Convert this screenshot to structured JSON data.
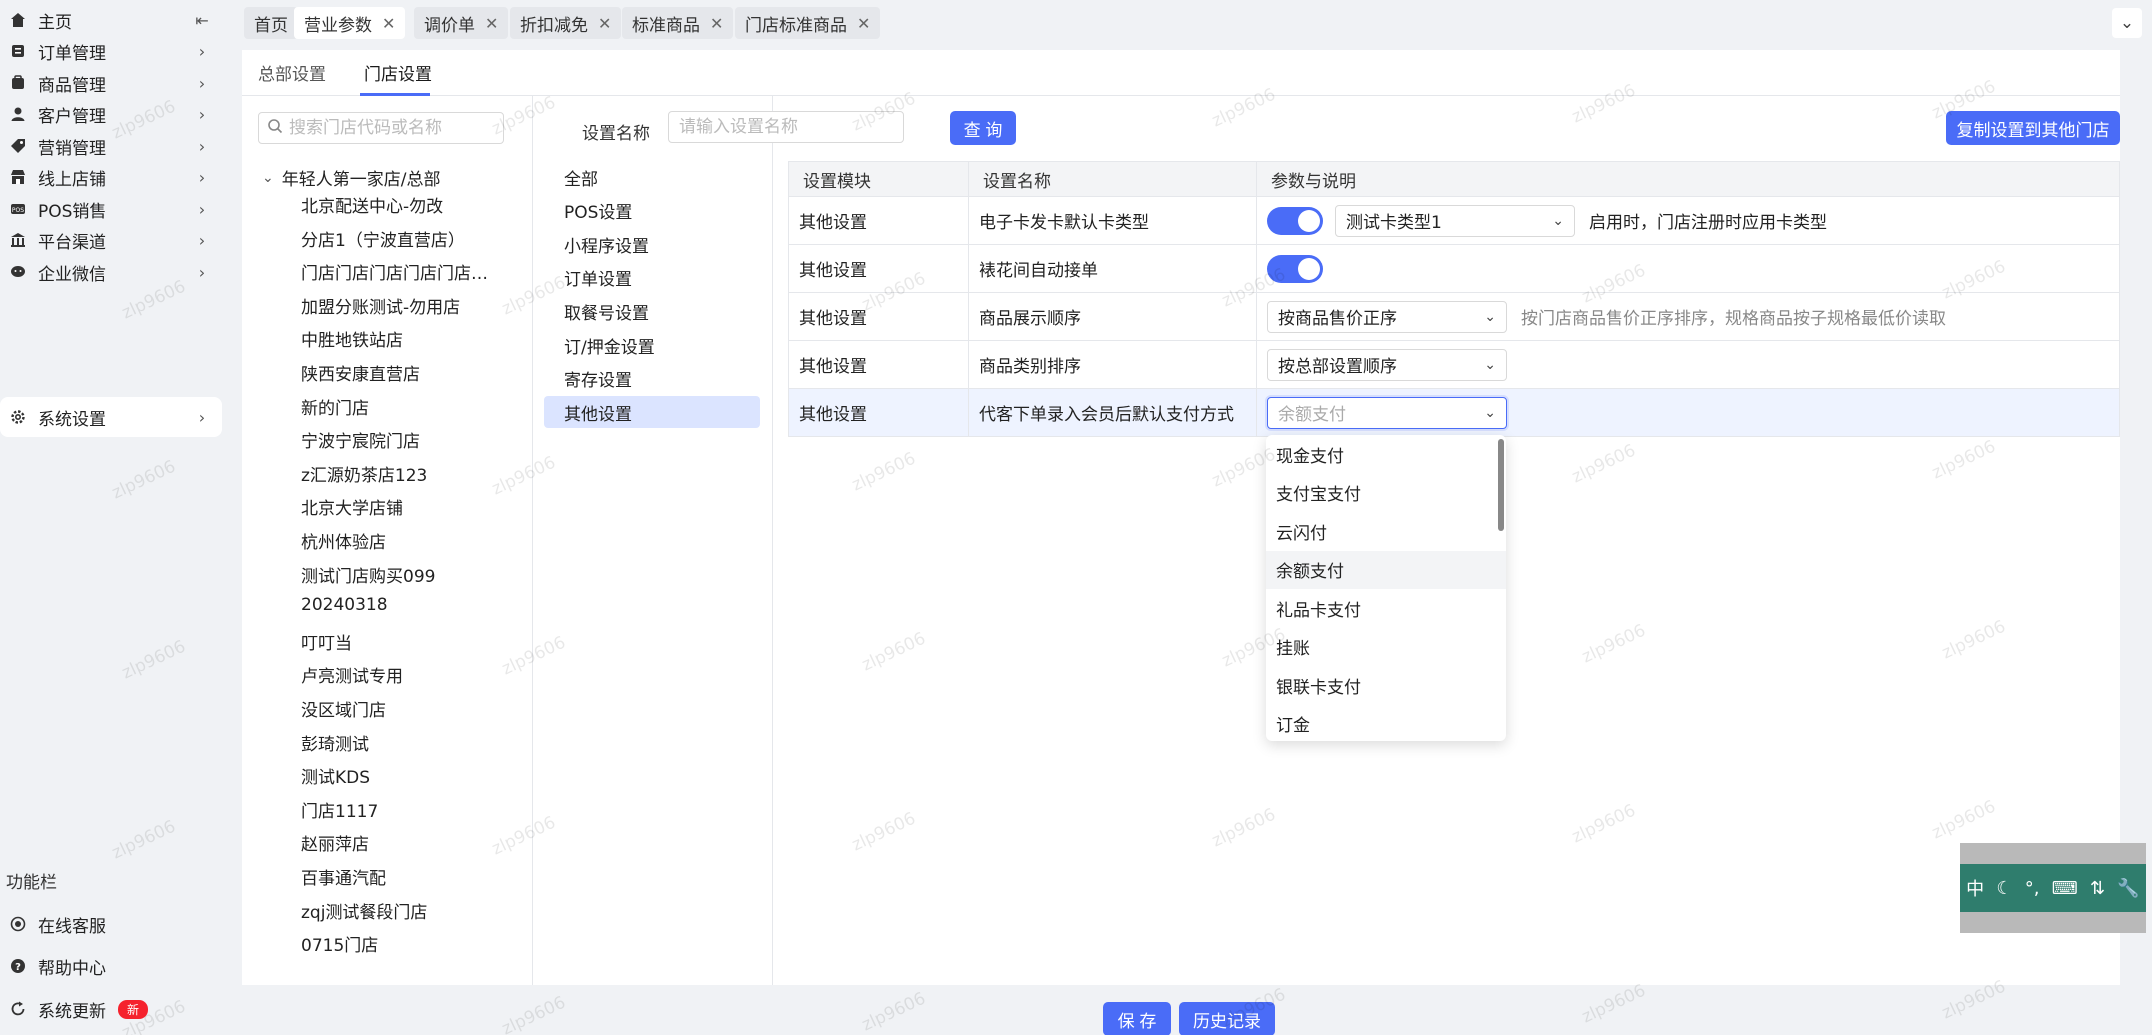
{
  "sidebar": {
    "items": [
      {
        "label": "主页",
        "icon": "home-icon",
        "trailing": "collapse"
      },
      {
        "label": "订单管理",
        "icon": "order-icon"
      },
      {
        "label": "商品管理",
        "icon": "goods-icon"
      },
      {
        "label": "客户管理",
        "icon": "user-icon"
      },
      {
        "label": "营销管理",
        "icon": "tag-icon"
      },
      {
        "label": "线上店铺",
        "icon": "shop-icon"
      },
      {
        "label": "POS销售",
        "icon": "pos-icon"
      },
      {
        "label": "平台渠道",
        "icon": "channel-icon"
      },
      {
        "label": "企业微信",
        "icon": "wechat-icon"
      },
      {
        "label": "系统设置",
        "icon": "gear-icon",
        "active": true
      }
    ],
    "func_title": "功能栏",
    "func_items": [
      {
        "label": "在线客服",
        "icon": "service-icon"
      },
      {
        "label": "帮助中心",
        "icon": "help-icon"
      },
      {
        "label": "系统更新",
        "icon": "refresh-icon",
        "badge": "新"
      }
    ]
  },
  "tabs": [
    {
      "label": "首页",
      "closable": false
    },
    {
      "label": "营业参数",
      "closable": true,
      "active": true
    },
    {
      "label": "调价单",
      "closable": true
    },
    {
      "label": "折扣减免",
      "closable": true
    },
    {
      "label": "标准商品",
      "closable": true
    },
    {
      "label": "门店标准商品",
      "closable": true
    }
  ],
  "subtabs": [
    {
      "label": "总部设置"
    },
    {
      "label": "门店设置",
      "active": true
    }
  ],
  "store_search": {
    "placeholder": "搜索门店代码或名称"
  },
  "tree_root": "年轻人第一家店/总部",
  "stores": [
    "北京配送中心-勿改",
    "分店1（宁波直营店）",
    "门店门店门店门店门店门店",
    "加盟分账测试-勿用店",
    "中胜地铁站店",
    "陕西安康直营店",
    "新的门店",
    "宁波宁宸院门店",
    "z汇源奶茶店123",
    "北京大学店铺",
    "杭州体验店",
    "测试门店购买099",
    "20240318",
    "叮叮当",
    "卢亮测试专用",
    "没区域门店",
    "彭琦测试",
    "测试KDS",
    "门店1117",
    "赵丽萍店",
    "百事通汽配",
    "zqj测试餐段门店",
    "0715门店"
  ],
  "categories": [
    {
      "label": "全部"
    },
    {
      "label": "POS设置"
    },
    {
      "label": "小程序设置"
    },
    {
      "label": "订单设置"
    },
    {
      "label": "取餐号设置"
    },
    {
      "label": "订/押金设置"
    },
    {
      "label": "寄存设置"
    },
    {
      "label": "其他设置",
      "active": true
    }
  ],
  "filter": {
    "label": "设置名称",
    "placeholder": "请输入设置名称",
    "query_button": "查 询",
    "copy_button": "复制设置到其他门店"
  },
  "table": {
    "headers": [
      "设置模块",
      "设置名称",
      "参数与说明"
    ],
    "rows": [
      {
        "module": "其他设置",
        "name": "电子卡发卡默认卡类型",
        "toggle": true,
        "select": "测试卡类型1",
        "desc": "启用时，门店注册时应用卡类型"
      },
      {
        "module": "其他设置",
        "name": "裱花间自动接单",
        "toggle": true,
        "select": null,
        "desc": ""
      },
      {
        "module": "其他设置",
        "name": "商品展示顺序",
        "toggle": false,
        "select": "按商品售价正序",
        "desc": "按门店商品售价正序排序，规格商品按子规格最低价读取"
      },
      {
        "module": "其他设置",
        "name": "商品类别排序",
        "toggle": false,
        "select": "按总部设置顺序",
        "desc": ""
      },
      {
        "module": "其他设置",
        "name": "代客下单录入会员后默认支付方式",
        "toggle": false,
        "select": "余额支付",
        "desc": "",
        "focused": true
      }
    ]
  },
  "dropdown": {
    "options": [
      "现金支付",
      "支付宝支付",
      "云闪付",
      "余额支付",
      "礼品卡支付",
      "挂账",
      "银联卡支付",
      "订金"
    ],
    "highlighted": "余额支付"
  },
  "footer": {
    "save_button": "保 存",
    "history_button": "历史记录"
  },
  "ime": {
    "items": [
      "中",
      "☾",
      "°,",
      "⌨",
      "⇅",
      "🔧"
    ]
  },
  "watermark": "zlp9606",
  "colors": {
    "accent": "#4a6cf7",
    "active_category_bg": "#dbe4ff",
    "ime_bg": "#2f7d6d",
    "badge": "#f5222d"
  }
}
